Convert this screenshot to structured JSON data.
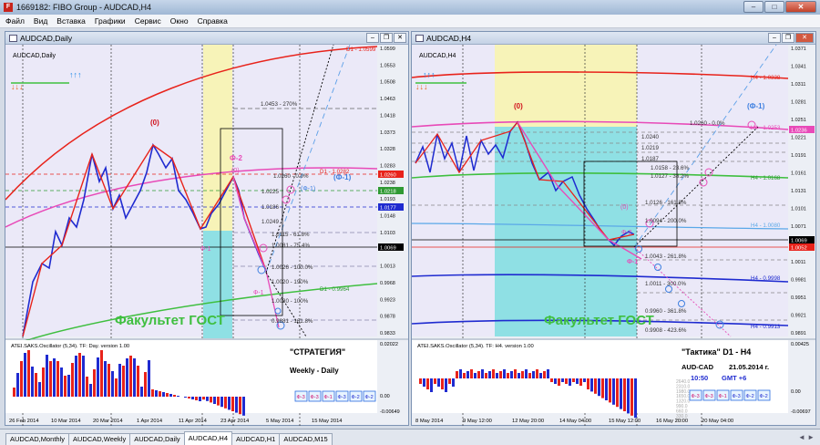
{
  "app": {
    "title": "1669182: FIBO Group - AUDCAD,H4",
    "icon_letter": "F"
  },
  "window_buttons": {
    "minimize": "–",
    "maximize": "□",
    "close": "✕"
  },
  "menu": [
    "Файл",
    "Вид",
    "Вставка",
    "Графики",
    "Сервис",
    "Окно",
    "Справка"
  ],
  "colors": {
    "bull": "#e8231b",
    "bear": "#1f2bd0",
    "pink": "#e84ab8",
    "fibo_yellow": "#f7f3b8",
    "fibo_cyan": "#8fe0e4",
    "bg": "#ebe9f8",
    "green": "#3fbf3f"
  },
  "left": {
    "window_title": "AUDCAD,Daily",
    "symbol_label": "AUDCAD,Daily",
    "prices": [
      "1.0599",
      "1.0553",
      "1.0508",
      "1.0463",
      "1.0418",
      "1.0373",
      "1.0328",
      "1.0283",
      "1.0238",
      "1.0193",
      "1.0148",
      "1.0103",
      "1.0058",
      "1.0013",
      "0.9968",
      "0.9923",
      "0.9878",
      "0.9833"
    ],
    "price_markers": [
      {
        "text": "1.0260",
        "color": "#e8231b"
      },
      {
        "text": "1.0218",
        "color": "#2f9a33"
      },
      {
        "text": "1.0177",
        "color": "#1f2bd0"
      },
      {
        "text": "1.0069",
        "color": "#000000"
      }
    ],
    "fibo_levels": [
      "1.0453 - 270%",
      "1.0260 - 0.0%",
      "1.0225",
      "1.0186",
      "1.0249",
      "1.0115 - 61.8%",
      "1.0081 - 75.4%",
      "1.0026 - 100.0%",
      "1.0020 - 190%",
      "1.0020 - 100%",
      "0.9881 - 161.8%"
    ],
    "line_labels": [
      {
        "text": "D1 - 1.0282"
      },
      {
        "text": "D1 - 0.9964"
      },
      {
        "text": "D1 - 1.0599"
      }
    ],
    "wave_labels": [
      "(0)",
      "Ф-2",
      "(0)",
      "Ф-1",
      "(Ф-1)",
      "(Ф-1)",
      "Ф-1"
    ],
    "watermark": "Факультет ГОСТ",
    "oscillator_label": "ATEI.SAKS.Oscillator (5,34). TF: Day. version 1.00",
    "osc_scale": [
      "0.02022",
      "0.00",
      "-0.00649"
    ],
    "strategy_title": "\"СТРАТЕГИЯ\"",
    "strategy_sub": "Weekly - Daily",
    "phase_buttons": [
      "Ф-3",
      "Ф-3",
      "Ф-1",
      "Ф-3",
      "Ф-2",
      "Ф-2"
    ],
    "dates": [
      "26 Feb 2014",
      "10 Mar 2014",
      "20 Mar 2014",
      "1 Apr 2014",
      "11 Apr 2014",
      "23 Apr 2014",
      "5 May 2014",
      "15 May 2014"
    ]
  },
  "right": {
    "window_title": "AUDCAD,H4",
    "symbol_label": "AUDCAD,H4",
    "prices": [
      "1.0371",
      "1.0341",
      "1.0311",
      "1.0281",
      "1.0251",
      "1.0221",
      "1.0191",
      "1.0161",
      "1.0131",
      "1.0101",
      "1.0071",
      "1.0041",
      "1.0011",
      "0.9981",
      "0.9951",
      "0.9921",
      "0.9891"
    ],
    "price_markers": [
      {
        "text": "1.0236",
        "color": "#e84ab8"
      },
      {
        "text": "1.0069",
        "color": "#000000"
      },
      {
        "text": "1.0052",
        "color": "#e8231b"
      }
    ],
    "fibo_levels": [
      "1.0260 - 0.0%",
      "1.0240",
      "1.0219",
      "1.0187",
      "1.0158 - 23.6%",
      "1.0127 - 38.2%",
      "1.0126 - 161.8%",
      "1.0094 - 200.0%",
      "1.0043 - 261.8%",
      "1.0011 - 300.0%",
      "0.9960 - 361.8%",
      "0.9908 - 423.6%"
    ],
    "line_labels": [
      "H4 - 1.0338",
      "H4 - 1.0253",
      "H4 - 1.0168",
      "H4 - 0.9998",
      "H4 - 0.9913",
      "H4 - 1.0080"
    ],
    "wave_labels": [
      "(0)",
      "(Ф-1)",
      "(0)",
      "Ф-2",
      "Ф-1"
    ],
    "watermark": "Факультет ГОСТ",
    "oscillator_label": "ATEI.SAKS.Oscillator (5,34). TF: H4. version 1.00",
    "osc_scale": [
      "0.00425",
      "0.00",
      "-0.00697"
    ],
    "tactic_title": "\"Тактика\"  D1 - H4",
    "pair": "AUD-CAD",
    "date": "21.05.2014  г.",
    "time": "10:50",
    "gmt": "GMT +6",
    "phase_buttons": [
      "Ф-3",
      "Ф-3",
      "Ф-1",
      "Ф-3",
      "Ф-2",
      "Ф-2"
    ],
    "volume_scale": [
      "2640.0",
      "2310.0",
      "1980.0",
      "1650.0",
      "1320.0",
      "990.0",
      "660.0",
      "330.0",
      "0.0"
    ],
    "dates": [
      "8 May 2014",
      "9 May 12:00",
      "12 May 20:00",
      "14 May 04:00",
      "15 May 12:00",
      "16 May 20:00",
      "20 May 04:00"
    ]
  },
  "tabs": [
    "AUDCAD,Monthly",
    "AUDCAD,Weekly",
    "AUDCAD,Daily",
    "AUDCAD,H4",
    "AUDCAD,H1",
    "AUDCAD,M15"
  ],
  "active_tab": "AUDCAD,H4",
  "tab_arrows": "◄ ►"
}
